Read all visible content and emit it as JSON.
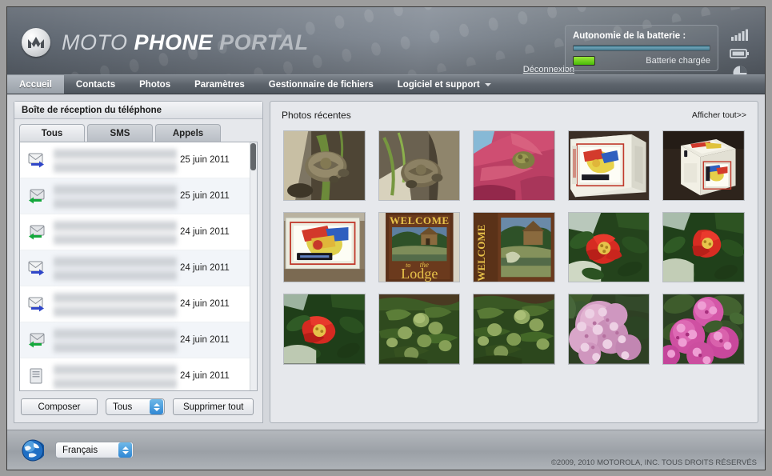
{
  "header": {
    "brand_word1": "MOTO",
    "brand_word2": "PHONE",
    "brand_word3": "PORTAL",
    "logo_icon": "motorola-m-logo",
    "logout_label": "Déconnexion",
    "battery_label": "Autonomie de la batterie :",
    "battery_state": "Batterie chargée",
    "battery_percent": 100,
    "system_icons": [
      "signal-bars-icon",
      "battery-icon",
      "memory-pie-icon"
    ],
    "colors": {
      "header_bg": "#6f777f",
      "battery_green": "#49bb08",
      "battery_bar": "#6fa3b6"
    }
  },
  "nav": {
    "items": [
      {
        "label": "Accueil",
        "active": true,
        "caret": false
      },
      {
        "label": "Contacts",
        "active": false,
        "caret": false
      },
      {
        "label": "Photos",
        "active": false,
        "caret": false
      },
      {
        "label": "Paramètres",
        "active": false,
        "caret": false
      },
      {
        "label": "Gestionnaire de fichiers",
        "active": false,
        "caret": false
      },
      {
        "label": "Logiciel et support",
        "active": false,
        "caret": true
      }
    ]
  },
  "inbox": {
    "title": "Boîte de réception du téléphone",
    "tabs": [
      {
        "label": "Tous",
        "active": true
      },
      {
        "label": "SMS",
        "active": false
      },
      {
        "label": "Appels",
        "active": false
      }
    ],
    "messages": [
      {
        "icon": "message-sent-icon",
        "direction": "sent",
        "date": "25 juin 2011"
      },
      {
        "icon": "message-received-icon",
        "direction": "received",
        "date": "25 juin 2011"
      },
      {
        "icon": "message-received-icon",
        "direction": "received",
        "date": "24 juin 2011"
      },
      {
        "icon": "message-sent-icon",
        "direction": "sent",
        "date": "24 juin 2011"
      },
      {
        "icon": "message-sent-icon",
        "direction": "sent",
        "date": "24 juin 2011"
      },
      {
        "icon": "message-received-icon",
        "direction": "received",
        "date": "24 juin 2011"
      },
      {
        "icon": "message-draft-icon",
        "direction": "draft",
        "date": "24 juin 2011"
      }
    ],
    "actions": {
      "compose_label": "Composer",
      "filter_value": "Tous",
      "delete_all_label": "Supprimer tout"
    }
  },
  "photos": {
    "title": "Photos récentes",
    "view_all_label": "Afficher tout>>",
    "items": [
      {
        "name": "tortoise-on-soil-1",
        "subject": "tortoise"
      },
      {
        "name": "tortoise-on-soil-2",
        "subject": "tortoise"
      },
      {
        "name": "pink-bromeliad-flower",
        "subject": "flower"
      },
      {
        "name": "decorative-tin-box-1",
        "subject": "tin"
      },
      {
        "name": "decorative-tin-box-2",
        "subject": "tin"
      },
      {
        "name": "tin-box-close-up",
        "subject": "tin"
      },
      {
        "name": "welcome-to-the-lodge-sign-1",
        "subject": "sign"
      },
      {
        "name": "welcome-to-the-lodge-sign-2",
        "subject": "sign"
      },
      {
        "name": "red-pomegranate-flower-1",
        "subject": "flower"
      },
      {
        "name": "red-pomegranate-flower-2",
        "subject": "flower"
      },
      {
        "name": "red-pomegranate-flower-3",
        "subject": "flower"
      },
      {
        "name": "green-fruit-on-tree-1",
        "subject": "fruit"
      },
      {
        "name": "green-fruit-on-tree-2",
        "subject": "fruit"
      },
      {
        "name": "pink-hydrangea-1",
        "subject": "flower"
      },
      {
        "name": "pink-hydrangea-2",
        "subject": "flower"
      }
    ]
  },
  "footer": {
    "globe_icon": "globe-icon",
    "language_value": "Français",
    "copyright": "©2009, 2010 MOTOROLA, INC. TOUS DROITS RÉSERVÉS"
  }
}
